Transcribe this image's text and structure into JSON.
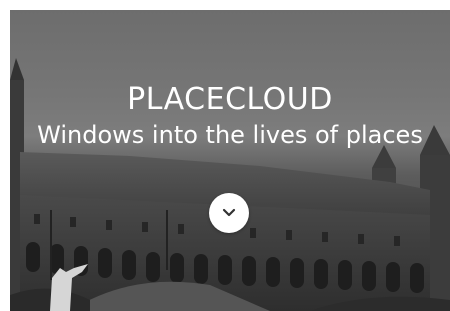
{
  "hero": {
    "title": "PLACECLOUD",
    "tagline": "Windows into the lives of places",
    "scroll_icon": "chevron-down-icon",
    "background_image": "grayscale photo of a palace building with arched colonnade"
  }
}
